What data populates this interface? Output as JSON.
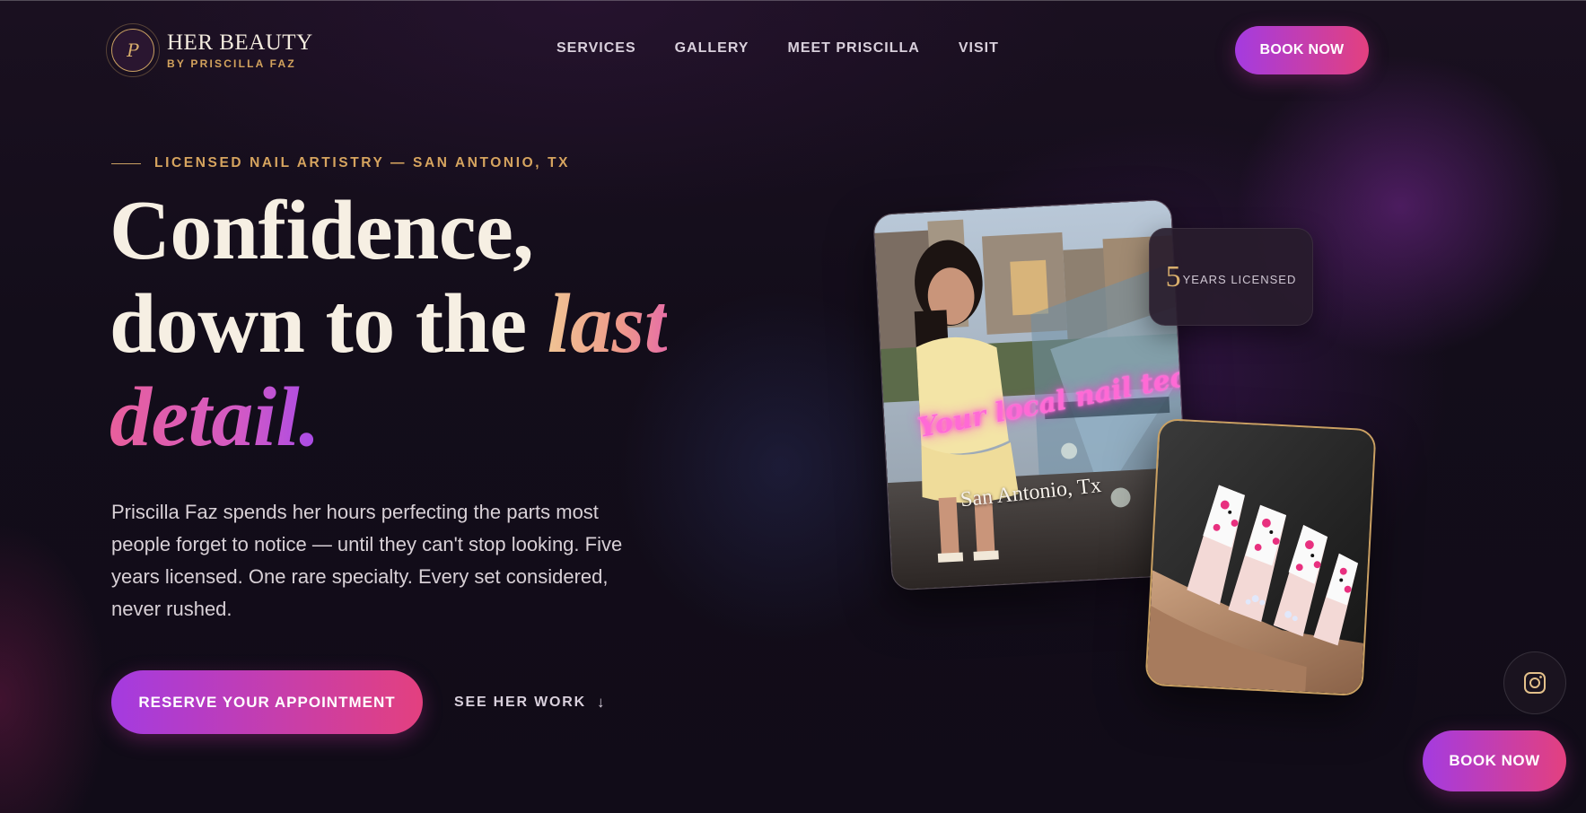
{
  "brand": {
    "monogram": "P",
    "name": "HER BEAUTY",
    "tagline": "BY PRISCILLA FAZ"
  },
  "nav": {
    "items": [
      "SERVICES",
      "GALLERY",
      "MEET PRISCILLA",
      "VISIT"
    ],
    "book_label": "BOOK NOW"
  },
  "hero": {
    "eyebrow": "LICENSED NAIL ARTISTRY — SAN ANTONIO, TX",
    "headline_1": "Confidence,",
    "headline_2": "down to the ",
    "headline_2_em": "last",
    "headline_3_em": "detail.",
    "lede": "Priscilla Faz spends her hours perfecting the parts most people forget to notice — until they can't stop looking. Five years licensed. One rare specialty. Every set considered, never rushed.",
    "primary_cta": "RESERVE YOUR APPOINTMENT",
    "secondary_cta": "SEE HER WORK",
    "secondary_cta_arrow": "↓"
  },
  "photos": {
    "main_overlay_text": "Your local nail tech",
    "main_location_text": "San Antonio, Tx"
  },
  "badge": {
    "number": "5",
    "label": "YEARS LICENSED"
  },
  "floating": {
    "instagram_icon": "instagram-icon",
    "book_label": "BOOK NOW"
  },
  "colors": {
    "gold": "#c9a062",
    "gradient_start": "#a43be0",
    "gradient_end": "#e3407f",
    "background": "#120d18"
  }
}
